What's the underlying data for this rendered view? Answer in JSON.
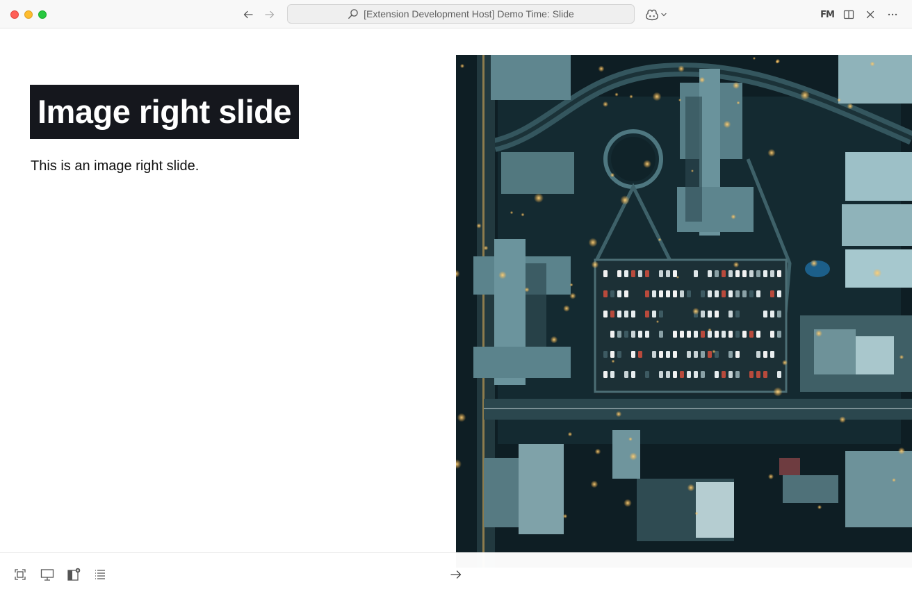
{
  "window": {
    "search_text": "[Extension Development Host] Demo Time: Slide",
    "toolbar_badge": "FM"
  },
  "icons": {
    "traffic_close": "close-traffic-light",
    "traffic_minimize": "minimize-traffic-light",
    "traffic_maximize": "maximize-traffic-light",
    "back": "arrow-left-icon",
    "forward": "arrow-right-icon",
    "search": "search-icon",
    "copilot": "copilot-icon",
    "split_editor": "split-editor-icon",
    "close_editor": "close-icon",
    "more": "more-icon"
  },
  "slide": {
    "heading": "Image right slide",
    "body": "This is an image right slide.",
    "layout": "image-right",
    "heading_bg": "#15171d",
    "heading_color": "#ffffff"
  },
  "bottom_toolbar": {
    "icons": [
      "fit-screen-icon",
      "presentation-icon",
      "layout-toggle-icon",
      "list-icon",
      "next-slide-arrow-icon"
    ]
  },
  "colors": {
    "titlebar_bg": "#f8f8f8",
    "traffic_red": "#ff5f57",
    "traffic_yellow": "#febc2e",
    "traffic_green": "#28c840"
  }
}
